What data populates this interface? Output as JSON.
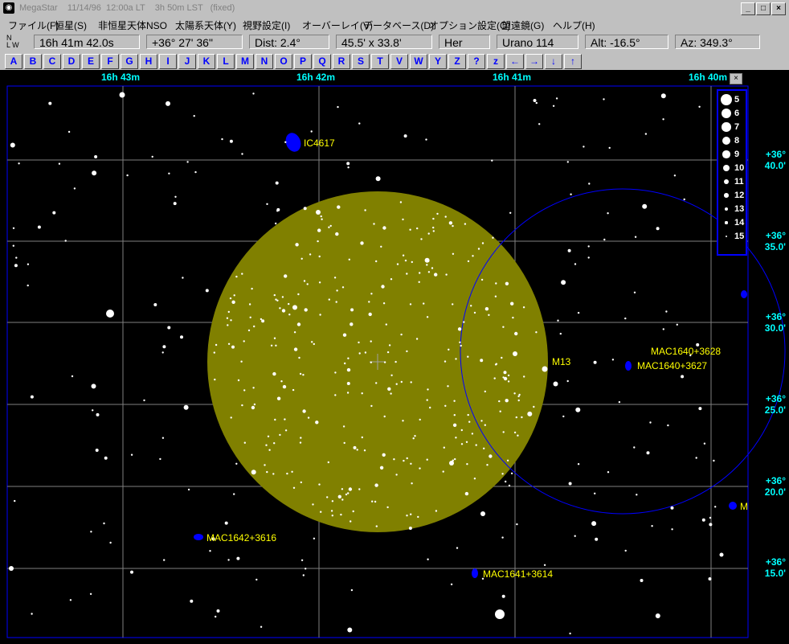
{
  "window": {
    "title": "MegaStar    11/14/96  12:00a LT    3h 50m LST   (fixed)",
    "minimize": "_",
    "maximize": "□",
    "close": "×"
  },
  "menu": [
    "ファイル(F)",
    "恒星(S)",
    "非恒星天体NSO",
    "太陽系天体(Y)",
    "視野設定(I)",
    "オーバーレイ(V)",
    "データベース(D)",
    "オプション設定(O)",
    "望遠鏡(G)",
    "ヘルプ(H)"
  ],
  "info": {
    "orientation_n": "N",
    "orientation_lw": "L W",
    "ra": "16h 41m 42.0s",
    "dec": "+36° 27' 36\"",
    "dist": "Dist: 2.4°",
    "fov": "45.5' x 33.8'",
    "constellation": "Her",
    "chart": "Urano 114",
    "alt": "Alt: -16.5°",
    "az": "Az: 349.3°"
  },
  "letter_buttons": [
    "A",
    "B",
    "C",
    "D",
    "E",
    "F",
    "G",
    "H",
    "I",
    "J",
    "K",
    "L",
    "M",
    "N",
    "O",
    "P",
    "Q",
    "R",
    "S",
    "T",
    "V",
    "W",
    "Y",
    "Z",
    "?",
    "z",
    "←",
    "→",
    "↓",
    "↑"
  ],
  "ra_labels": [
    "16h 43m",
    "16h 42m",
    "16h 41m",
    "16h 40m"
  ],
  "dec_labels": [
    {
      "deg": "+36°",
      "min": "40.0'"
    },
    {
      "deg": "+36°",
      "min": "35.0'"
    },
    {
      "deg": "+36°",
      "min": "30.0'"
    },
    {
      "deg": "+36°",
      "min": "25.0'"
    },
    {
      "deg": "+36°",
      "min": "20.0'"
    },
    {
      "deg": "+36°",
      "min": "15.0'"
    }
  ],
  "objects": {
    "ic4617": "IC4617",
    "m13": "M13",
    "mac1640_3628": "MAC1640+3628",
    "mac1640_3627": "MAC1640+3627",
    "mac1642_3616": "MAC1642+3616",
    "mac1641_3614": "MAC1641+3614",
    "m_partial": "M"
  },
  "legend": {
    "close": "×",
    "magnitudes": [
      "5",
      "6",
      "7",
      "8",
      "9",
      "10",
      "11",
      "12",
      "13",
      "14",
      "15"
    ]
  },
  "colors": {
    "sky": "#000000",
    "grid": "#808080",
    "cluster_fill": "#808000",
    "fov_circle": "#0000ff",
    "labels": "#ffff00",
    "coord_labels": "#00ffff",
    "galaxy": "#0000ff"
  }
}
